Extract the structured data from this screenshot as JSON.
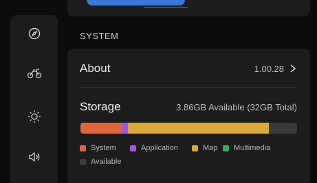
{
  "section": {
    "title": "SYSTEM"
  },
  "about": {
    "label": "About",
    "value": "1.00.28"
  },
  "storage": {
    "label": "Storage",
    "value": "3.86GB Available (32GB Total)",
    "segments": [
      {
        "name": "System",
        "fraction": 0.19,
        "color": "#e0663d"
      },
      {
        "name": "Application",
        "fraction": 0.03,
        "color": "#9b5bd8"
      },
      {
        "name": "Map",
        "fraction": 0.65,
        "color": "#d9a93a"
      },
      {
        "name": "Multimedia",
        "fraction": 0.0,
        "color": "#3cab5c"
      },
      {
        "name": "Available",
        "fraction": 0.13,
        "color": "#3a3a3c"
      }
    ]
  },
  "legend": {
    "system": "System",
    "application": "Application",
    "map": "Map",
    "multimedia": "Multimedia",
    "available": "Available"
  },
  "colors": {
    "system": "#e0663d",
    "application": "#9b5bd8",
    "map": "#d9a93a",
    "multimedia": "#3cab5c",
    "available": "#3a3a3c",
    "accent": "#3a78d8"
  },
  "rail_icons": [
    "compass-icon",
    "motorcycle-icon",
    "brightness-icon",
    "volume-icon"
  ]
}
